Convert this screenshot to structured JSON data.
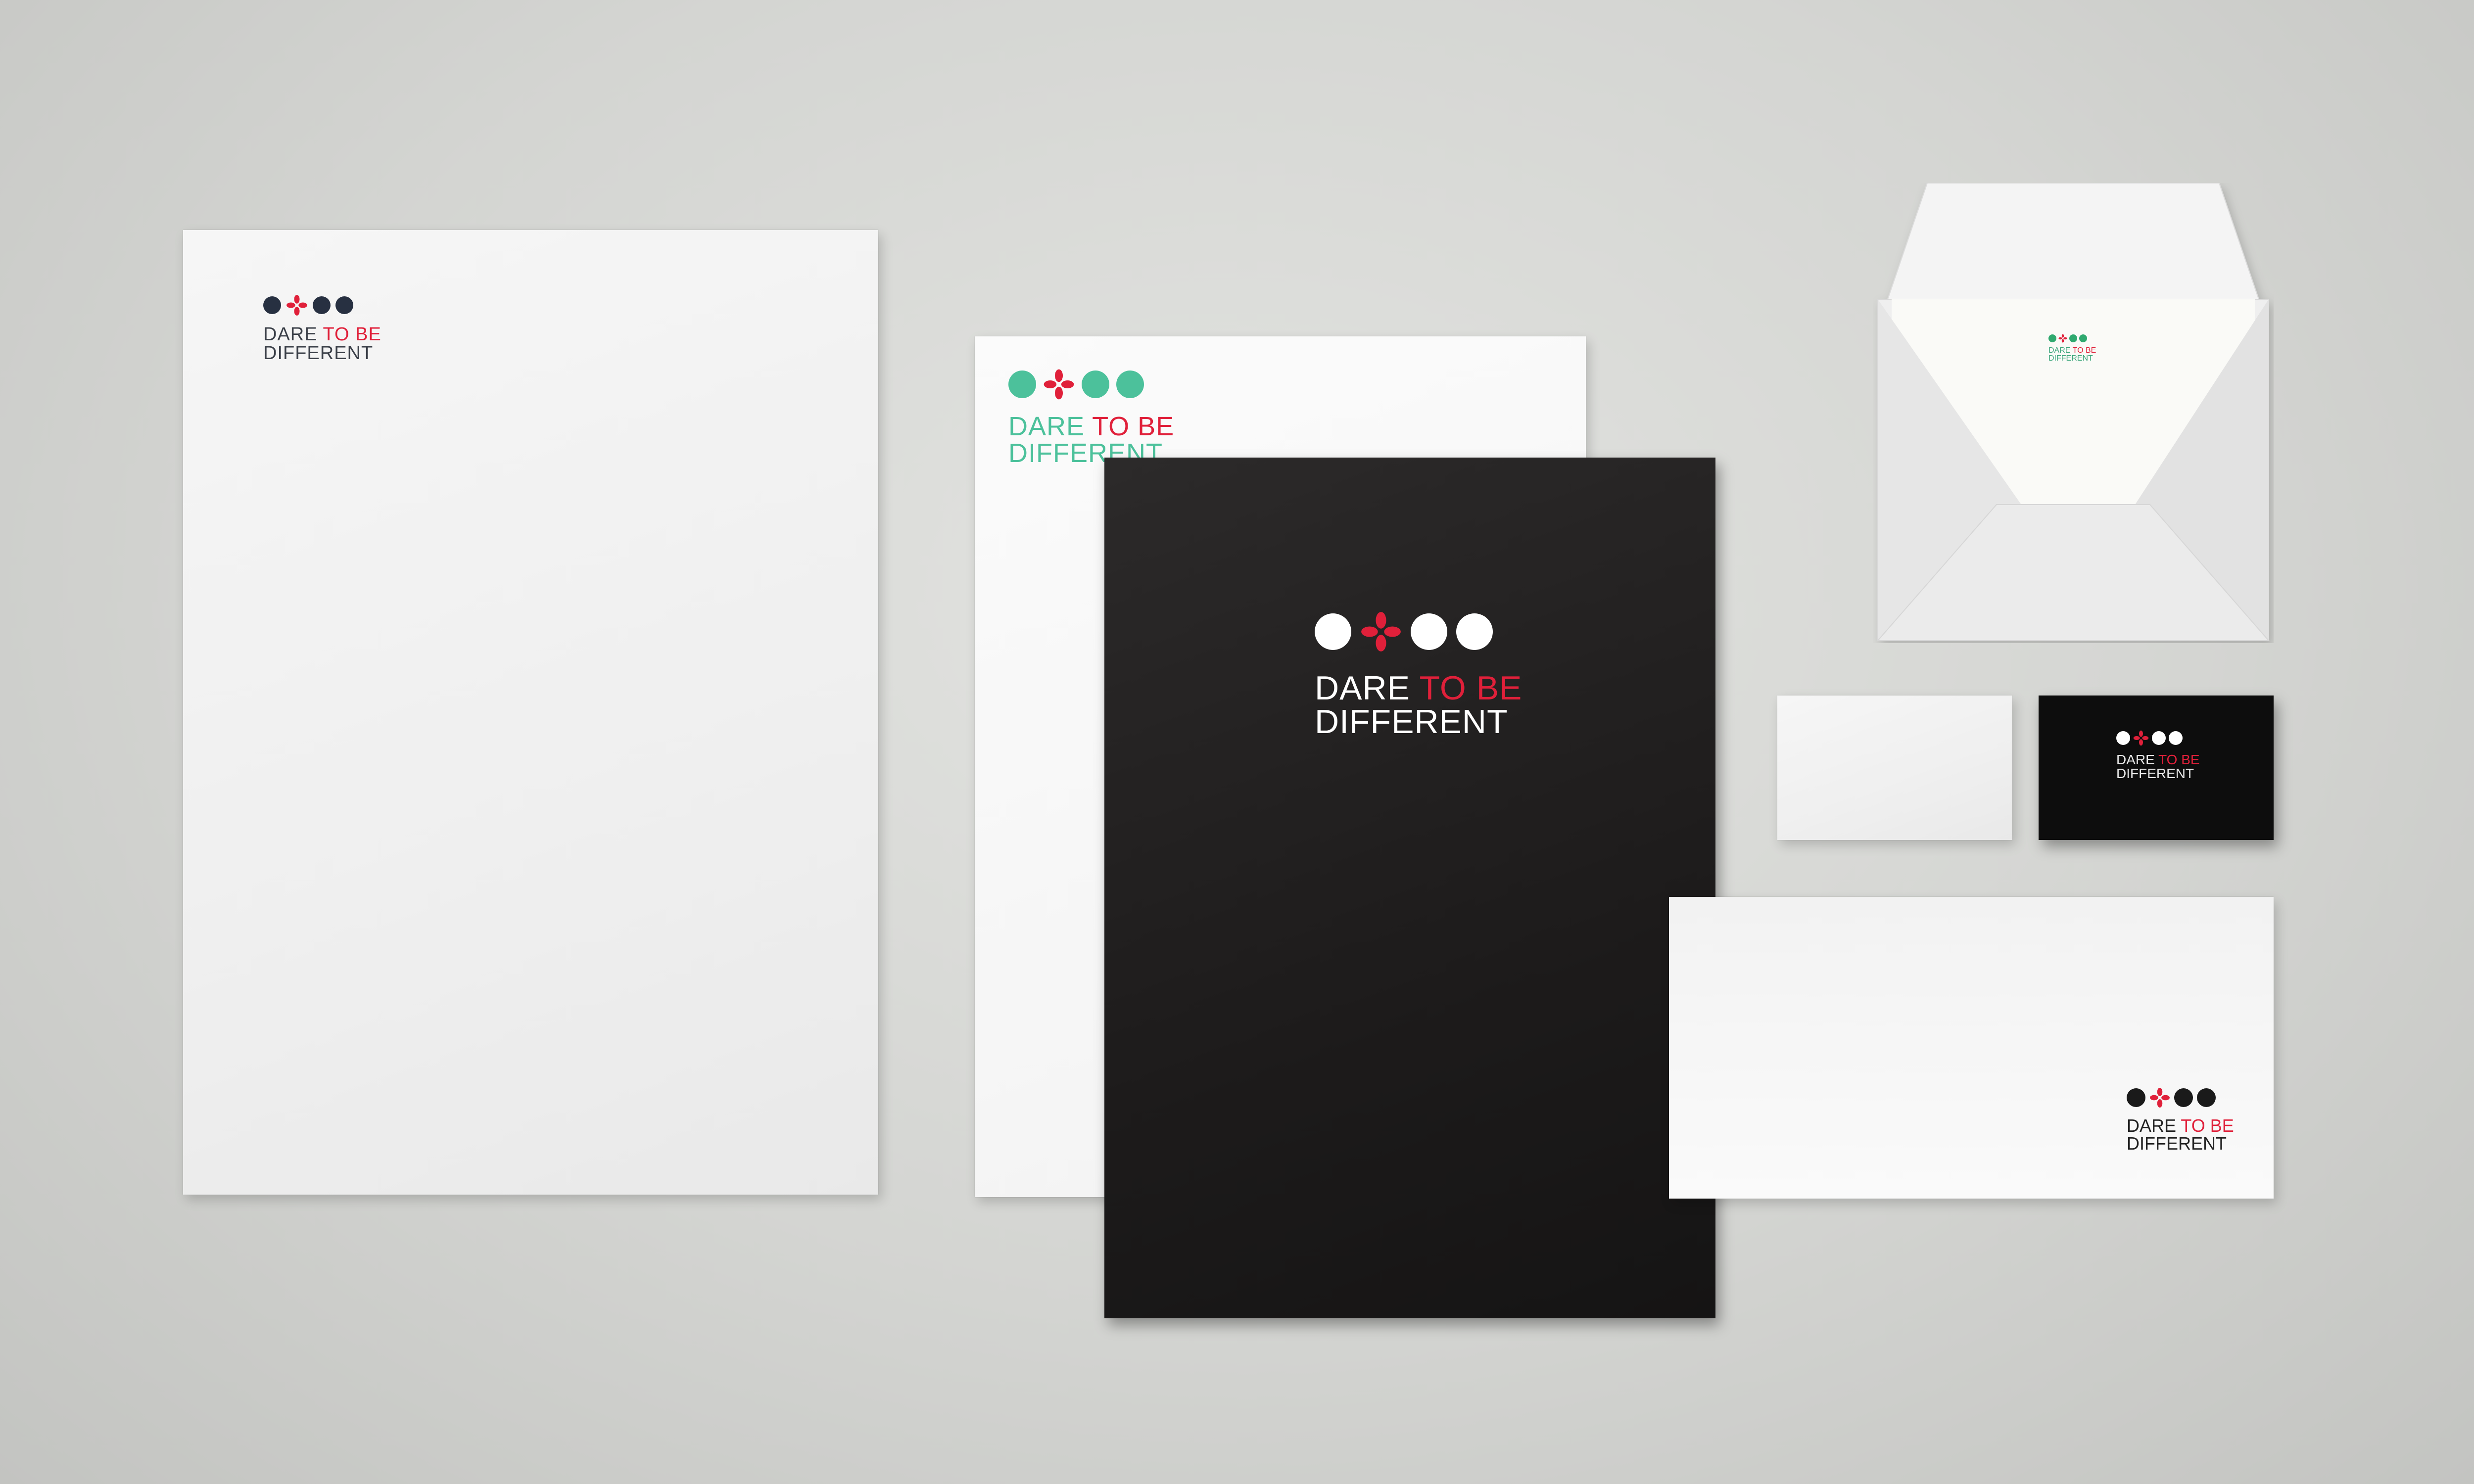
{
  "brand": {
    "line1_a": "DARE",
    "line1_b": "TO BE",
    "line2": "DIFFERENT"
  },
  "colors": {
    "background": "#d4d5d2",
    "dark_navy": "#273041",
    "accent_red": "#e0203a",
    "teal": "#4cc19b",
    "paper": "#f2f2f2",
    "black_paper": "#1d1b1b"
  }
}
